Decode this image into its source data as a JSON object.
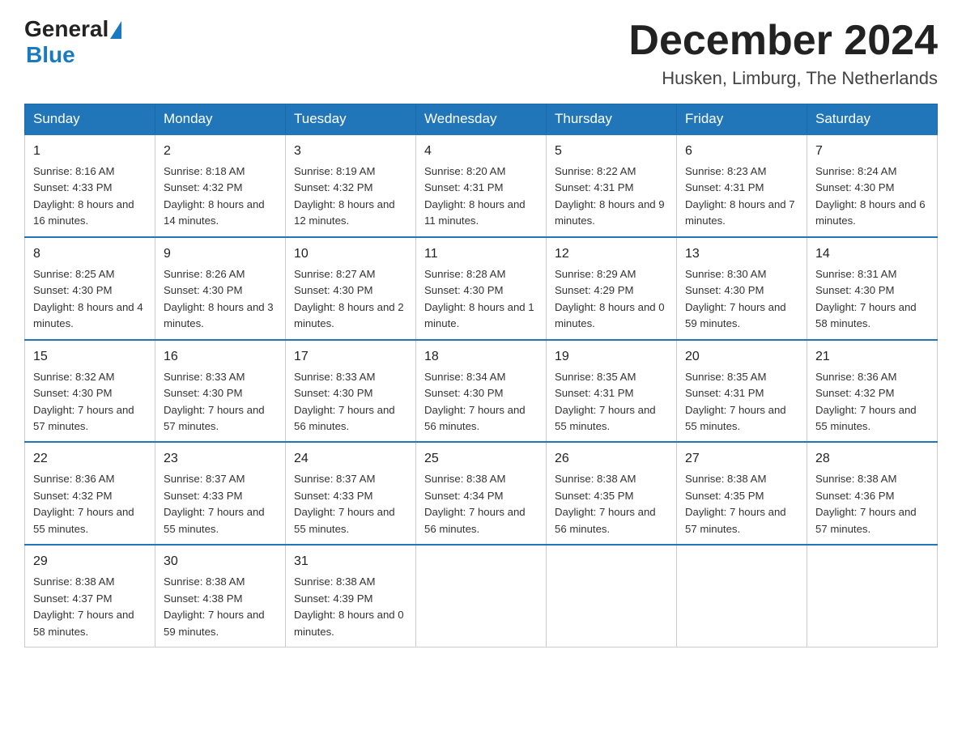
{
  "header": {
    "logo_general": "General",
    "logo_blue": "Blue",
    "month_title": "December 2024",
    "location": "Husken, Limburg, The Netherlands"
  },
  "weekdays": [
    "Sunday",
    "Monday",
    "Tuesday",
    "Wednesday",
    "Thursday",
    "Friday",
    "Saturday"
  ],
  "weeks": [
    [
      {
        "day": "1",
        "sunrise": "8:16 AM",
        "sunset": "4:33 PM",
        "daylight": "8 hours and 16 minutes."
      },
      {
        "day": "2",
        "sunrise": "8:18 AM",
        "sunset": "4:32 PM",
        "daylight": "8 hours and 14 minutes."
      },
      {
        "day": "3",
        "sunrise": "8:19 AM",
        "sunset": "4:32 PM",
        "daylight": "8 hours and 12 minutes."
      },
      {
        "day": "4",
        "sunrise": "8:20 AM",
        "sunset": "4:31 PM",
        "daylight": "8 hours and 11 minutes."
      },
      {
        "day": "5",
        "sunrise": "8:22 AM",
        "sunset": "4:31 PM",
        "daylight": "8 hours and 9 minutes."
      },
      {
        "day": "6",
        "sunrise": "8:23 AM",
        "sunset": "4:31 PM",
        "daylight": "8 hours and 7 minutes."
      },
      {
        "day": "7",
        "sunrise": "8:24 AM",
        "sunset": "4:30 PM",
        "daylight": "8 hours and 6 minutes."
      }
    ],
    [
      {
        "day": "8",
        "sunrise": "8:25 AM",
        "sunset": "4:30 PM",
        "daylight": "8 hours and 4 minutes."
      },
      {
        "day": "9",
        "sunrise": "8:26 AM",
        "sunset": "4:30 PM",
        "daylight": "8 hours and 3 minutes."
      },
      {
        "day": "10",
        "sunrise": "8:27 AM",
        "sunset": "4:30 PM",
        "daylight": "8 hours and 2 minutes."
      },
      {
        "day": "11",
        "sunrise": "8:28 AM",
        "sunset": "4:30 PM",
        "daylight": "8 hours and 1 minute."
      },
      {
        "day": "12",
        "sunrise": "8:29 AM",
        "sunset": "4:29 PM",
        "daylight": "8 hours and 0 minutes."
      },
      {
        "day": "13",
        "sunrise": "8:30 AM",
        "sunset": "4:30 PM",
        "daylight": "7 hours and 59 minutes."
      },
      {
        "day": "14",
        "sunrise": "8:31 AM",
        "sunset": "4:30 PM",
        "daylight": "7 hours and 58 minutes."
      }
    ],
    [
      {
        "day": "15",
        "sunrise": "8:32 AM",
        "sunset": "4:30 PM",
        "daylight": "7 hours and 57 minutes."
      },
      {
        "day": "16",
        "sunrise": "8:33 AM",
        "sunset": "4:30 PM",
        "daylight": "7 hours and 57 minutes."
      },
      {
        "day": "17",
        "sunrise": "8:33 AM",
        "sunset": "4:30 PM",
        "daylight": "7 hours and 56 minutes."
      },
      {
        "day": "18",
        "sunrise": "8:34 AM",
        "sunset": "4:30 PM",
        "daylight": "7 hours and 56 minutes."
      },
      {
        "day": "19",
        "sunrise": "8:35 AM",
        "sunset": "4:31 PM",
        "daylight": "7 hours and 55 minutes."
      },
      {
        "day": "20",
        "sunrise": "8:35 AM",
        "sunset": "4:31 PM",
        "daylight": "7 hours and 55 minutes."
      },
      {
        "day": "21",
        "sunrise": "8:36 AM",
        "sunset": "4:32 PM",
        "daylight": "7 hours and 55 minutes."
      }
    ],
    [
      {
        "day": "22",
        "sunrise": "8:36 AM",
        "sunset": "4:32 PM",
        "daylight": "7 hours and 55 minutes."
      },
      {
        "day": "23",
        "sunrise": "8:37 AM",
        "sunset": "4:33 PM",
        "daylight": "7 hours and 55 minutes."
      },
      {
        "day": "24",
        "sunrise": "8:37 AM",
        "sunset": "4:33 PM",
        "daylight": "7 hours and 55 minutes."
      },
      {
        "day": "25",
        "sunrise": "8:38 AM",
        "sunset": "4:34 PM",
        "daylight": "7 hours and 56 minutes."
      },
      {
        "day": "26",
        "sunrise": "8:38 AM",
        "sunset": "4:35 PM",
        "daylight": "7 hours and 56 minutes."
      },
      {
        "day": "27",
        "sunrise": "8:38 AM",
        "sunset": "4:35 PM",
        "daylight": "7 hours and 57 minutes."
      },
      {
        "day": "28",
        "sunrise": "8:38 AM",
        "sunset": "4:36 PM",
        "daylight": "7 hours and 57 minutes."
      }
    ],
    [
      {
        "day": "29",
        "sunrise": "8:38 AM",
        "sunset": "4:37 PM",
        "daylight": "7 hours and 58 minutes."
      },
      {
        "day": "30",
        "sunrise": "8:38 AM",
        "sunset": "4:38 PM",
        "daylight": "7 hours and 59 minutes."
      },
      {
        "day": "31",
        "sunrise": "8:38 AM",
        "sunset": "4:39 PM",
        "daylight": "8 hours and 0 minutes."
      },
      null,
      null,
      null,
      null
    ]
  ]
}
